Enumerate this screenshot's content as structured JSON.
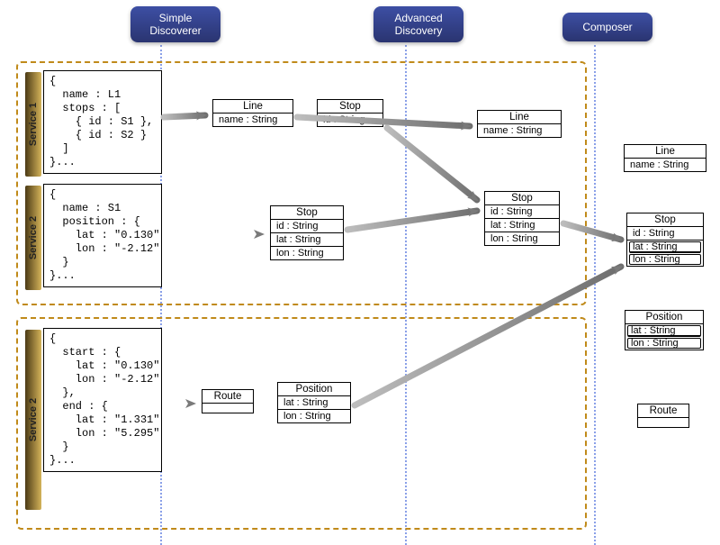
{
  "headers": {
    "col1": {
      "line1": "Simple",
      "line2": "Discoverer"
    },
    "col2": {
      "line1": "Advanced",
      "line2": "Discovery"
    },
    "col3": {
      "line1": "Composer",
      "line2": ""
    }
  },
  "services": {
    "s1": {
      "label": "Service 1"
    },
    "s2": {
      "label": "Service 2"
    },
    "s3": {
      "label": "Service 2"
    }
  },
  "code": {
    "svc1": "{\n  name : L1\n  stops : [\n    { id : S1 },\n    { id : S2 }\n  ]\n}...",
    "svc2": "{\n  name : S1\n  position : {\n    lat : \"0.130\"\n    lon : \"-2.12\"\n  }\n}...",
    "svc3": "{\n  start : {\n    lat : \"0.130\"\n    lon : \"-2.12\"\n  },\n  end : {\n    lat : \"1.331\"\n    lon : \"5.295\"\n  }\n}..."
  },
  "uml": {
    "line": {
      "title": "Line",
      "rows": [
        "name : String"
      ]
    },
    "stop_small": {
      "title": "Stop",
      "rows": [
        "id : String"
      ]
    },
    "stop_mid": {
      "title": "Stop",
      "rows": [
        "id : String",
        "lat : String",
        "lon : String"
      ]
    },
    "line_adv": {
      "title": "Line",
      "rows": [
        "name : String"
      ]
    },
    "stop_adv": {
      "title": "Stop",
      "rows": [
        "id : String",
        "lat : String",
        "lon : String"
      ]
    },
    "route": {
      "title": "Route",
      "rows": [
        ""
      ]
    },
    "position": {
      "title": "Position",
      "rows": [
        "lat : String",
        "lon : String"
      ]
    },
    "line_comp": {
      "title": "Line",
      "rows": [
        "name : String"
      ]
    },
    "stop_comp": {
      "title": "Stop",
      "rows": [
        "id : String",
        "lat : String",
        "lon : String"
      ]
    },
    "pos_comp": {
      "title": "Position",
      "rows": [
        "lat : String",
        "lon : String"
      ]
    },
    "route_comp": {
      "title": "Route",
      "rows": [
        ""
      ]
    }
  },
  "chart_data": {
    "type": "diagram",
    "columns": [
      "Simple Discoverer",
      "Advanced Discovery",
      "Composer"
    ],
    "service_groups": [
      {
        "services": [
          {
            "name": "Service 1",
            "json_sample": {
              "name": "L1",
              "stops": [
                {
                  "id": "S1"
                },
                {
                  "id": "S2"
                }
              ]
            },
            "simple_discovery": [
              {
                "class": "Line",
                "fields": {
                  "name": "String"
                }
              },
              {
                "class": "Stop",
                "fields": {
                  "id": "String"
                }
              }
            ]
          },
          {
            "name": "Service 2",
            "json_sample": {
              "name": "S1",
              "position": {
                "lat": "0.130",
                "lon": "-2.12"
              }
            },
            "simple_discovery": [
              {
                "class": "Stop",
                "fields": {
                  "id": "String",
                  "lat": "String",
                  "lon": "String"
                }
              }
            ]
          }
        ],
        "advanced_discovery": [
          {
            "class": "Line",
            "fields": {
              "name": "String"
            }
          },
          {
            "class": "Stop",
            "fields": {
              "id": "String",
              "lat": "String",
              "lon": "String"
            }
          }
        ]
      },
      {
        "services": [
          {
            "name": "Service 2",
            "json_sample": {
              "start": {
                "lat": "0.130",
                "lon": "-2.12"
              },
              "end": {
                "lat": "1.331",
                "lon": "5.295"
              }
            },
            "simple_discovery": [
              {
                "class": "Route",
                "fields": {}
              },
              {
                "class": "Position",
                "fields": {
                  "lat": "String",
                  "lon": "String"
                }
              }
            ]
          }
        ],
        "advanced_discovery": []
      }
    ],
    "composer_output": [
      {
        "class": "Line",
        "fields": {
          "name": "String"
        }
      },
      {
        "class": "Stop",
        "fields": {
          "id": "String",
          "lat": "String",
          "lon": "String"
        },
        "highlighted_fields": [
          "lat",
          "lon"
        ]
      },
      {
        "class": "Position",
        "fields": {
          "lat": "String",
          "lon": "String"
        },
        "highlighted_fields": [
          "lat",
          "lon"
        ]
      },
      {
        "class": "Route",
        "fields": {}
      }
    ],
    "arrows": [
      [
        "svc1-code",
        "line-simple"
      ],
      [
        "svc2-code",
        "stop-mid-simple"
      ],
      [
        "line-simple",
        "line-adv"
      ],
      [
        "stop-small-simple",
        "stop-adv"
      ],
      [
        "stop-mid-simple",
        "stop-adv"
      ],
      [
        "svc3-code",
        "route-simple"
      ],
      [
        "stop-adv",
        "stop-composer"
      ],
      [
        "position-simple",
        "stop-composer"
      ]
    ]
  }
}
